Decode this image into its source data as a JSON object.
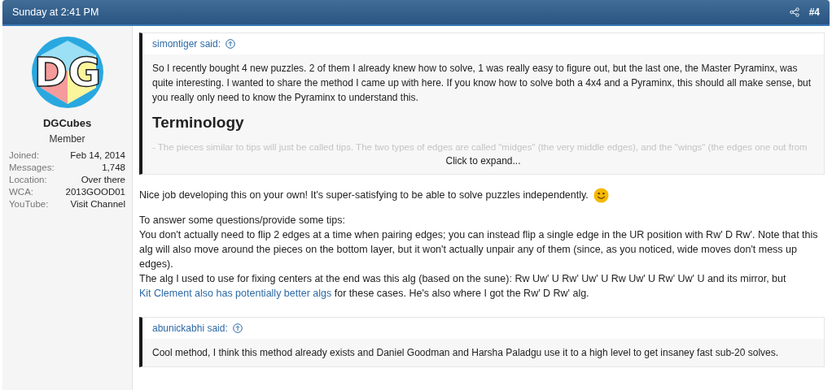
{
  "header": {
    "date": "Sunday at 2:41 PM",
    "permalink": "#4"
  },
  "user": {
    "avatar_text": "DG",
    "name": "DGCubes",
    "title": "Member",
    "stats": [
      {
        "label": "Joined:",
        "value": "Feb 14, 2014"
      },
      {
        "label": "Messages:",
        "value": "1,748"
      },
      {
        "label": "Location:",
        "value": "Over there"
      },
      {
        "label": "WCA:",
        "value": "2013GOOD01"
      },
      {
        "label": "YouTube:",
        "value": "Visit Channel"
      }
    ]
  },
  "content": [
    {
      "kind": "quote",
      "author": "simontiger said:",
      "text": "So I recently bought 4 new puzzles. 2 of them I already knew how to solve, 1 was really easy to figure out, but the last one, the Master Pyraminx, was quite interesting. I wanted to share the method I came up with here. If you know how to solve both a 4x4 and a Pyraminx, this should all make sense, but you really only need to know the Pyraminx to understand this.",
      "heading": "Terminology",
      "faded": "- The pieces similar to tips will just be called tips. The two types of edges are called \"midges\" (the very middle edges), and the \"wings\" (the edges one out from",
      "expand": "Click to expand..."
    },
    {
      "kind": "paragraph",
      "text": "Nice job developing this on your own! It's super-satisfying to be able to solve puzzles independently.",
      "emoji": true
    },
    {
      "kind": "line",
      "text": "To answer some questions/provide some tips:"
    },
    {
      "kind": "line",
      "text": "You don't actually need to flip 2 edges at a time when pairing edges; you can instead flip a single edge in the UR position with Rw' D Rw'. Note that this alg will also move around the pieces on the bottom layer, but it won't actually unpair any of them (since, as you noticed, wide moves don't mess up edges)."
    },
    {
      "kind": "linked",
      "before": "The alg I used to use for fixing centers at the end was this alg (based on the sune): Rw Uw' U Rw' Uw' U Rw Uw' U Rw' Uw' U and its mirror, but",
      "link": "Kit Clement also has potentially better algs",
      "after": "for these cases. He's also where I got the Rw' D Rw' alg."
    },
    {
      "kind": "quote",
      "author": "abunickabhi said:",
      "text": "Cool method, I think this method already exists and Daniel Goodman and Harsha Paladgu use it to a high level to get insaney fast sub-20 solves."
    }
  ]
}
